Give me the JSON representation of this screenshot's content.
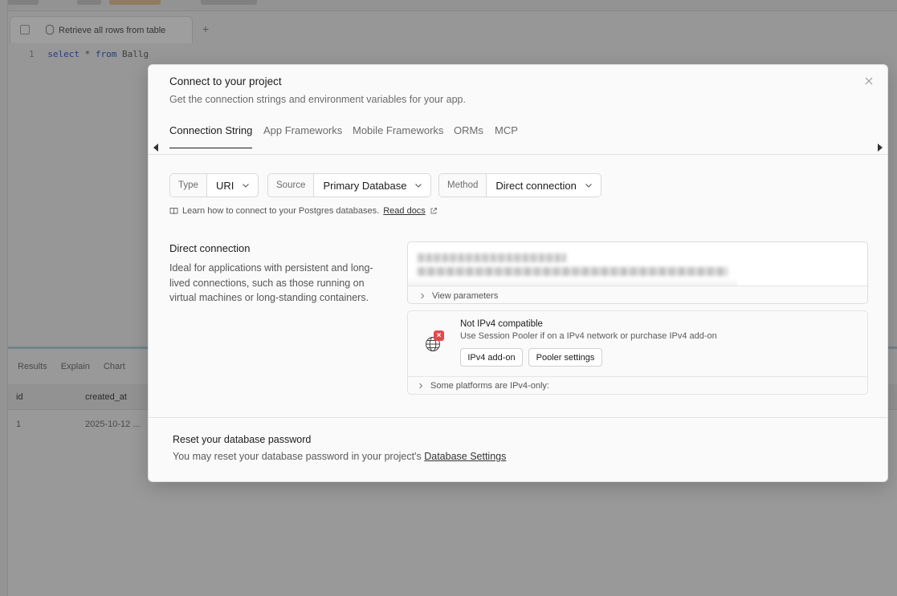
{
  "background": {
    "tab_label": "Retrieve all rows from table",
    "code_line_number": "1",
    "code_kw_select": "select",
    "code_star": "*",
    "code_kw_from": "from",
    "code_table": "Ballg",
    "results_tabs": [
      "Results",
      "Explain",
      "Chart"
    ],
    "col_headers": [
      "id",
      "created_at"
    ],
    "row_values": [
      "1",
      "2025-10-12 ..."
    ]
  },
  "modal": {
    "title": "Connect to your project",
    "subtitle": "Get the connection strings and environment variables for your app.",
    "tabs": [
      {
        "label": "Connection String",
        "active": true
      },
      {
        "label": "App Frameworks",
        "active": false
      },
      {
        "label": "Mobile Frameworks",
        "active": false
      },
      {
        "label": "ORMs",
        "active": false
      },
      {
        "label": "MCP",
        "active": false
      }
    ],
    "selectors": {
      "type": {
        "label": "Type",
        "value": "URI"
      },
      "source": {
        "label": "Source",
        "value": "Primary Database"
      },
      "method": {
        "label": "Method",
        "value": "Direct connection"
      }
    },
    "learn": {
      "text": "Learn how to connect to your Postgres databases.",
      "link": "Read docs"
    },
    "direct_connection": {
      "title": "Direct connection",
      "description": "Ideal for applications with persistent and long-lived connections, such as those running on virtual machines or long-standing containers.",
      "view_parameters": "View parameters"
    },
    "ipv4": {
      "title": "Not IPv4 compatible",
      "subtitle": "Use Session Pooler if on a IPv4 network or purchase IPv4 add-on",
      "addon_button": "IPv4 add-on",
      "pooler_button": "Pooler settings",
      "platforms": "Some platforms are IPv4-only:"
    },
    "reset": {
      "title": "Reset your database password",
      "text": "You may reset your database password in your project's",
      "link": "Database Settings"
    }
  },
  "colors": {
    "overlay": "rgba(0,0,0,0.38)",
    "error_badge": "#e5484d",
    "text_primary": "#1c1c1c",
    "text_muted": "#6b6b6b"
  }
}
